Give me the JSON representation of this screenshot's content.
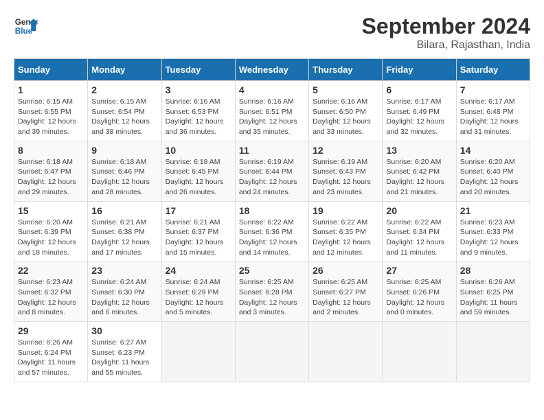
{
  "header": {
    "logo_line1": "General",
    "logo_line2": "Blue",
    "main_title": "September 2024",
    "sub_title": "Bilara, Rajasthan, India"
  },
  "days_of_week": [
    "Sunday",
    "Monday",
    "Tuesday",
    "Wednesday",
    "Thursday",
    "Friday",
    "Saturday"
  ],
  "weeks": [
    [
      {
        "day": "1",
        "info": "Sunrise: 6:15 AM\nSunset: 6:55 PM\nDaylight: 12 hours\nand 39 minutes."
      },
      {
        "day": "2",
        "info": "Sunrise: 6:15 AM\nSunset: 6:54 PM\nDaylight: 12 hours\nand 38 minutes."
      },
      {
        "day": "3",
        "info": "Sunrise: 6:16 AM\nSunset: 6:53 PM\nDaylight: 12 hours\nand 36 minutes."
      },
      {
        "day": "4",
        "info": "Sunrise: 6:16 AM\nSunset: 6:51 PM\nDaylight: 12 hours\nand 35 minutes."
      },
      {
        "day": "5",
        "info": "Sunrise: 6:16 AM\nSunset: 6:50 PM\nDaylight: 12 hours\nand 33 minutes."
      },
      {
        "day": "6",
        "info": "Sunrise: 6:17 AM\nSunset: 6:49 PM\nDaylight: 12 hours\nand 32 minutes."
      },
      {
        "day": "7",
        "info": "Sunrise: 6:17 AM\nSunset: 6:48 PM\nDaylight: 12 hours\nand 31 minutes."
      }
    ],
    [
      {
        "day": "8",
        "info": "Sunrise: 6:18 AM\nSunset: 6:47 PM\nDaylight: 12 hours\nand 29 minutes."
      },
      {
        "day": "9",
        "info": "Sunrise: 6:18 AM\nSunset: 6:46 PM\nDaylight: 12 hours\nand 28 minutes."
      },
      {
        "day": "10",
        "info": "Sunrise: 6:18 AM\nSunset: 6:45 PM\nDaylight: 12 hours\nand 26 minutes."
      },
      {
        "day": "11",
        "info": "Sunrise: 6:19 AM\nSunset: 6:44 PM\nDaylight: 12 hours\nand 24 minutes."
      },
      {
        "day": "12",
        "info": "Sunrise: 6:19 AM\nSunset: 6:43 PM\nDaylight: 12 hours\nand 23 minutes."
      },
      {
        "day": "13",
        "info": "Sunrise: 6:20 AM\nSunset: 6:42 PM\nDaylight: 12 hours\nand 21 minutes."
      },
      {
        "day": "14",
        "info": "Sunrise: 6:20 AM\nSunset: 6:40 PM\nDaylight: 12 hours\nand 20 minutes."
      }
    ],
    [
      {
        "day": "15",
        "info": "Sunrise: 6:20 AM\nSunset: 6:39 PM\nDaylight: 12 hours\nand 18 minutes."
      },
      {
        "day": "16",
        "info": "Sunrise: 6:21 AM\nSunset: 6:38 PM\nDaylight: 12 hours\nand 17 minutes."
      },
      {
        "day": "17",
        "info": "Sunrise: 6:21 AM\nSunset: 6:37 PM\nDaylight: 12 hours\nand 15 minutes."
      },
      {
        "day": "18",
        "info": "Sunrise: 6:22 AM\nSunset: 6:36 PM\nDaylight: 12 hours\nand 14 minutes."
      },
      {
        "day": "19",
        "info": "Sunrise: 6:22 AM\nSunset: 6:35 PM\nDaylight: 12 hours\nand 12 minutes."
      },
      {
        "day": "20",
        "info": "Sunrise: 6:22 AM\nSunset: 6:34 PM\nDaylight: 12 hours\nand 11 minutes."
      },
      {
        "day": "21",
        "info": "Sunrise: 6:23 AM\nSunset: 6:33 PM\nDaylight: 12 hours\nand 9 minutes."
      }
    ],
    [
      {
        "day": "22",
        "info": "Sunrise: 6:23 AM\nSunset: 6:32 PM\nDaylight: 12 hours\nand 8 minutes."
      },
      {
        "day": "23",
        "info": "Sunrise: 6:24 AM\nSunset: 6:30 PM\nDaylight: 12 hours\nand 6 minutes."
      },
      {
        "day": "24",
        "info": "Sunrise: 6:24 AM\nSunset: 6:29 PM\nDaylight: 12 hours\nand 5 minutes."
      },
      {
        "day": "25",
        "info": "Sunrise: 6:25 AM\nSunset: 6:28 PM\nDaylight: 12 hours\nand 3 minutes."
      },
      {
        "day": "26",
        "info": "Sunrise: 6:25 AM\nSunset: 6:27 PM\nDaylight: 12 hours\nand 2 minutes."
      },
      {
        "day": "27",
        "info": "Sunrise: 6:25 AM\nSunset: 6:26 PM\nDaylight: 12 hours\nand 0 minutes."
      },
      {
        "day": "28",
        "info": "Sunrise: 6:26 AM\nSunset: 6:25 PM\nDaylight: 11 hours\nand 59 minutes."
      }
    ],
    [
      {
        "day": "29",
        "info": "Sunrise: 6:26 AM\nSunset: 6:24 PM\nDaylight: 11 hours\nand 57 minutes."
      },
      {
        "day": "30",
        "info": "Sunrise: 6:27 AM\nSunset: 6:23 PM\nDaylight: 11 hours\nand 55 minutes."
      },
      {
        "day": "",
        "info": ""
      },
      {
        "day": "",
        "info": ""
      },
      {
        "day": "",
        "info": ""
      },
      {
        "day": "",
        "info": ""
      },
      {
        "day": "",
        "info": ""
      }
    ]
  ]
}
